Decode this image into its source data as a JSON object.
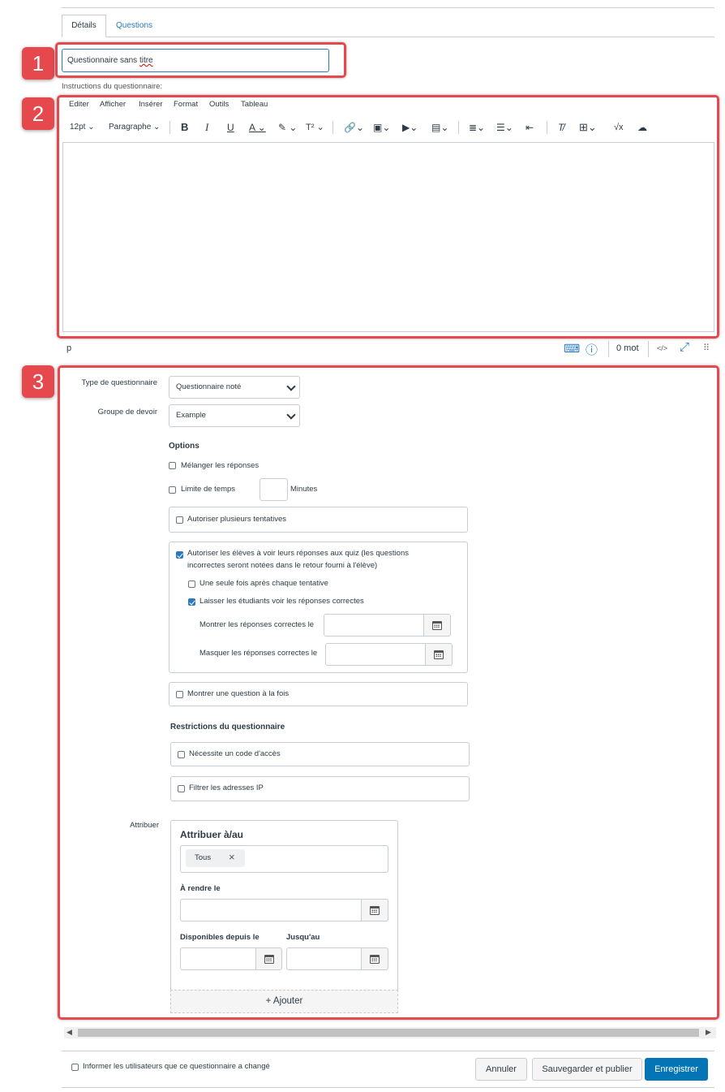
{
  "tabs": {
    "details": "Détails",
    "questions": "Questions"
  },
  "markers": {
    "m1": "1",
    "m2": "2",
    "m3": "3"
  },
  "title": {
    "value_a": "Questionnaire sans ",
    "value_b": "titre"
  },
  "instructions_label": "Instructions du questionnaire:",
  "editor": {
    "menu": [
      "Editer",
      "Afficher",
      "Insérer",
      "Format",
      "Outils",
      "Tableau"
    ],
    "font_size": "12pt",
    "block": "Paragraphe",
    "status_path": "p",
    "word_count": "0 mot",
    "html_toggle": "</>"
  },
  "settings": {
    "quiz_type_label": "Type de questionnaire",
    "quiz_type_value": "Questionnaire noté",
    "group_label": "Groupe de devoir",
    "group_value": "Example",
    "options_heading": "Options",
    "shuffle": "Mélanger les réponses",
    "time_limit": "Limite de temps",
    "minutes": "Minutes",
    "multiple_attempts": "Autoriser plusieurs tentatives",
    "see_responses_line1": "Autoriser les élèves à voir leurs réponses aux quiz (les questions",
    "see_responses_line2": "incorrectes seront notées dans le retour fourni à l'élève)",
    "once_after": "Une seule fois après chaque tentative",
    "show_correct": "Laisser les étudiants voir les réponses correctes",
    "show_correct_at": "Montrer les réponses correctes le",
    "hide_correct_at": "Masquer les réponses correctes le",
    "one_question": "Montrer une question à la fois",
    "restrictions_heading": "Restrictions du questionnaire",
    "access_code": "Nécessite un code d'accès",
    "ip_filter": "Filtrer les adresses IP"
  },
  "assign": {
    "label": "Attribuer",
    "heading": "Attribuer à/au",
    "chip": "Tous",
    "due_label": "À rendre le",
    "available_label": "Disponibles depuis le",
    "until_label": "Jusqu'au",
    "add_label": "+ Ajouter"
  },
  "footer": {
    "notify": "Informer les utilisateurs que ce questionnaire a changé",
    "cancel": "Annuler",
    "save_publish": "Sauvegarder et publier",
    "save": "Enregistrer"
  },
  "colors": {
    "accent": "#0374b5",
    "marker": "#e5484d",
    "link": "#2b7abc"
  }
}
